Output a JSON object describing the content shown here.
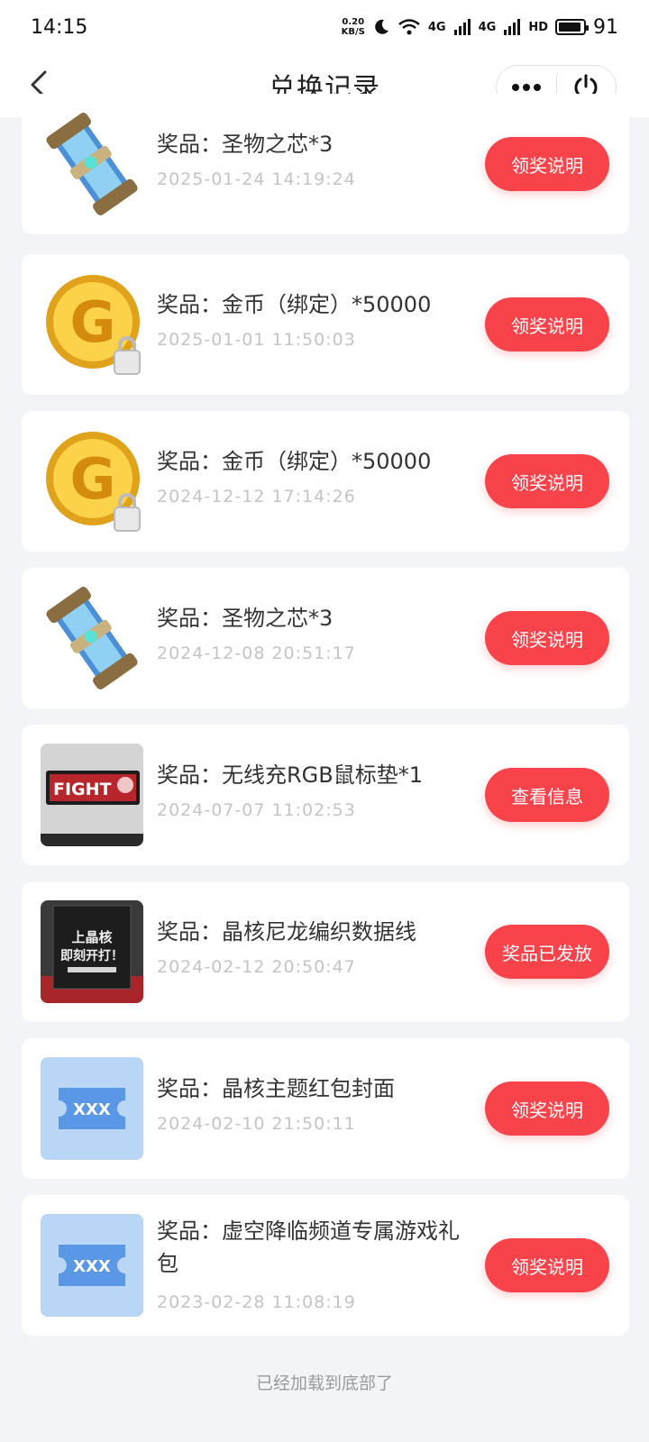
{
  "status_bar": {
    "time": "14:15",
    "net_speed_value": "0.20",
    "net_speed_unit": "KB/S",
    "signal_1": "4G",
    "signal_2": "4G",
    "hd": "HD",
    "battery": "91",
    "battery_level": 0.91
  },
  "nav": {
    "title": "兑换记录"
  },
  "colors": {
    "accent": "#f8434b",
    "background": "#f3f4f8",
    "coupon_blue": "#b9d6f7",
    "coupon_blue_dark": "#5a98e6"
  },
  "records": [
    {
      "name": "奖品：圣物之芯*3",
      "time": "2025-01-24  14:19:24",
      "action": "领奖说明",
      "icon": "relic-core-icon"
    },
    {
      "name": "奖品：金币（绑定）*50000",
      "time": "2025-01-01  11:50:03",
      "action": "领奖说明",
      "icon": "gold-coin-icon"
    },
    {
      "name": "奖品：金币（绑定）*50000",
      "time": "2024-12-12  17:14:26",
      "action": "领奖说明",
      "icon": "gold-coin-icon"
    },
    {
      "name": "奖品：圣物之芯*3",
      "time": "2024-12-08  20:51:17",
      "action": "领奖说明",
      "icon": "relic-core-icon"
    },
    {
      "name": "奖品：无线充RGB鼠标垫*1",
      "time": "2024-07-07  11:02:53",
      "action": "查看信息",
      "icon": "mousepad-photo",
      "thumb_text": "FIGHT"
    },
    {
      "name": "奖品：晶核尼龙编织数据线",
      "time": "2024-02-12  20:50:47",
      "action": "奖品已发放",
      "icon": "cable-box-photo",
      "thumb_text": "上晶核\n即刻开打！"
    },
    {
      "name": "奖品：晶核主题红包封面",
      "time": "2024-02-10  21:50:11",
      "action": "领奖说明",
      "icon": "ticket-icon",
      "thumb_text": "XXX"
    },
    {
      "name": "奖品：虚空降临频道专属游戏礼包",
      "time": "2023-02-28  11:08:19",
      "action": "领奖说明",
      "icon": "ticket-icon",
      "thumb_text": "XXX"
    }
  ],
  "footer": "已经加载到底部了"
}
